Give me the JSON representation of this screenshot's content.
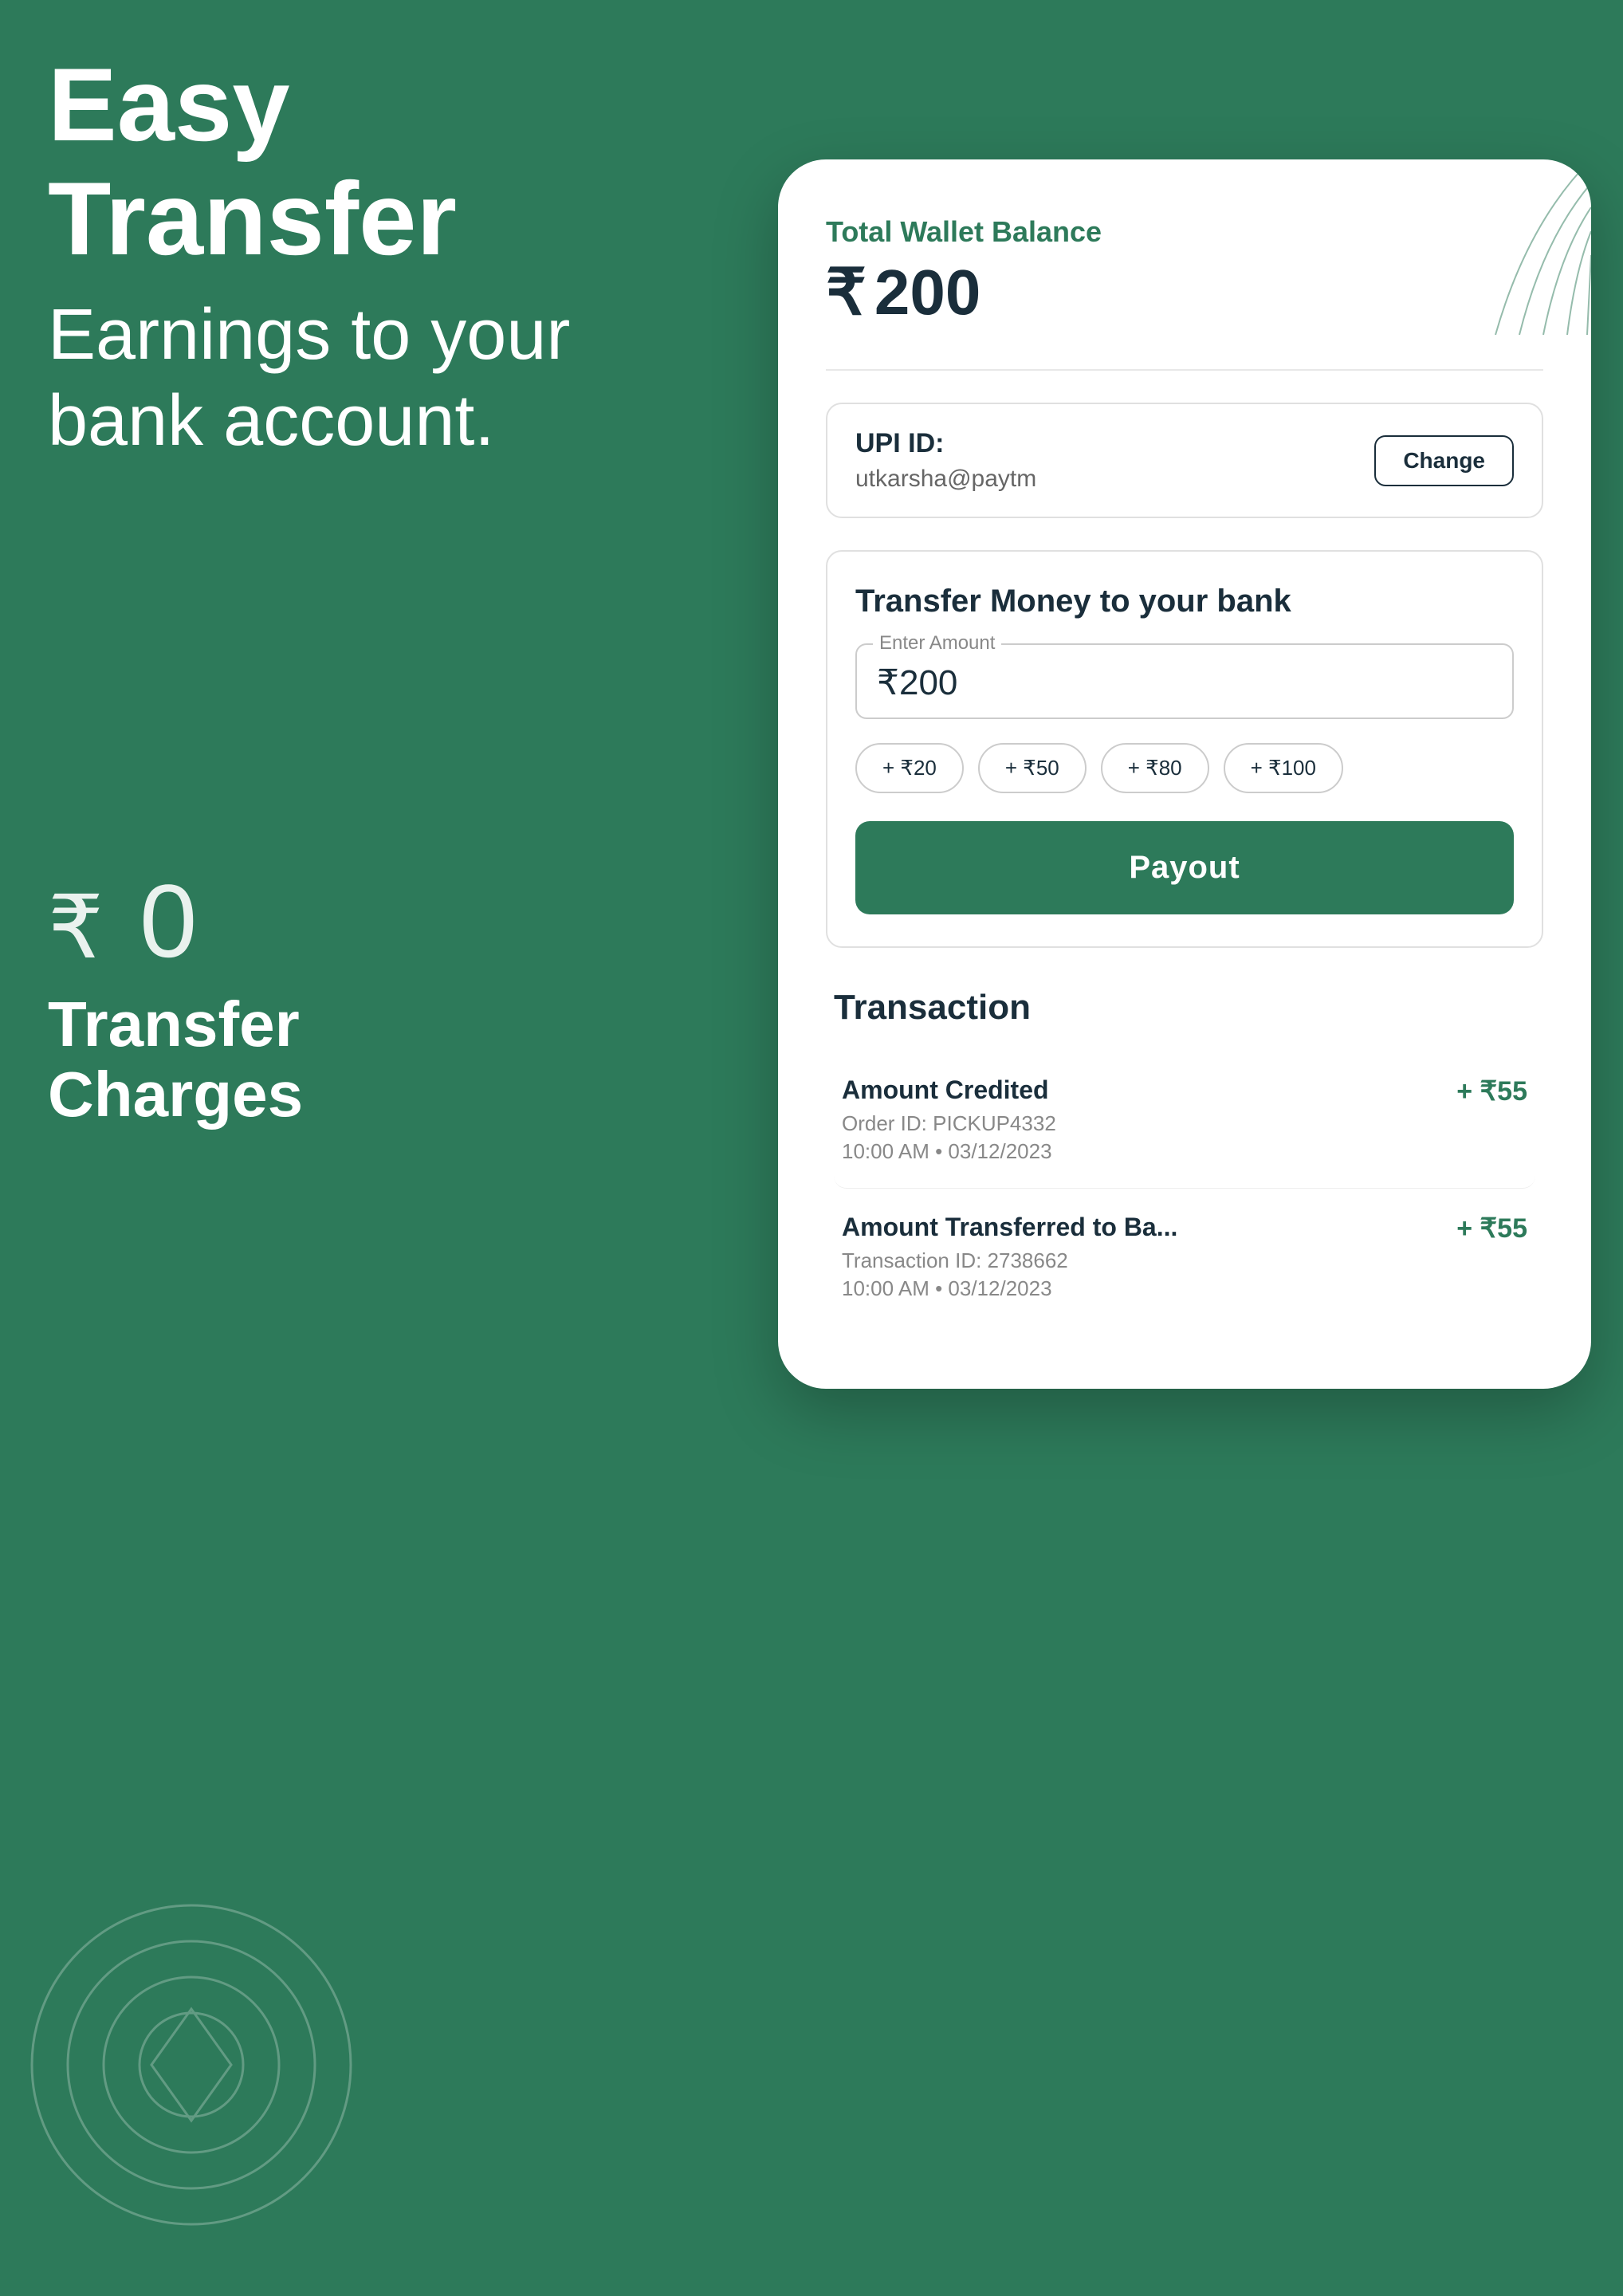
{
  "background": {
    "color": "#2d7a5a"
  },
  "left": {
    "main_title": "Easy Transfer",
    "subtitle_line1": "Earnings to your",
    "subtitle_line2": "bank account.",
    "zero_charges_symbol": "₹0",
    "transfer_charges_line1": "Transfer",
    "transfer_charges_line2": "Charges"
  },
  "card": {
    "wallet": {
      "label": "Total Wallet Balance",
      "currency_symbol": "₹",
      "amount": "200"
    },
    "upi": {
      "id_label": "UPI ID:",
      "id_value": "utkarsha@paytm",
      "change_button": "Change"
    },
    "transfer": {
      "title": "Transfer Money to your bank",
      "amount_input_label": "Enter Amount",
      "amount_input_value": "₹200",
      "quick_amounts": [
        "+ ₹20",
        "+ ₹50",
        "+ ₹80",
        "+ ₹100"
      ],
      "payout_button": "Payout"
    },
    "transaction": {
      "title": "Transaction",
      "items": [
        {
          "title": "Amount Credited",
          "subtitle": "Order ID: PICKUP4332",
          "time": "10:00 AM • 03/12/2023",
          "amount": "+ ₹55"
        },
        {
          "title": "Amount Transferred to Ba...",
          "subtitle": "Transaction ID: 2738662",
          "time": "10:00 AM • 03/12/2023",
          "amount": "+ ₹55"
        }
      ]
    }
  }
}
